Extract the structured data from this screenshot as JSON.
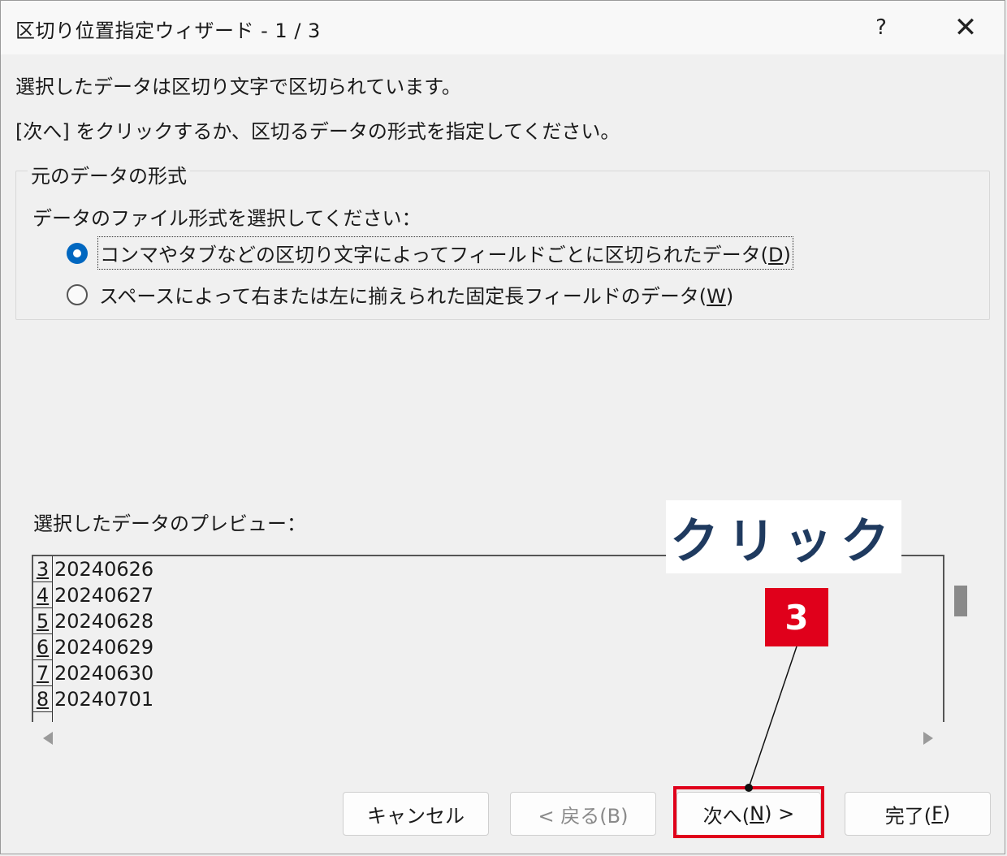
{
  "window": {
    "title": "区切り位置指定ウィザード - 1 / 3",
    "help": "?",
    "close": "✕"
  },
  "intro": {
    "line1": "選択したデータは区切り文字で区切られています。",
    "line2": "[次へ] をクリックするか、区切るデータの形式を指定してください。"
  },
  "format_group": {
    "legend": "元のデータの形式",
    "prompt": "データのファイル形式を選択してください：",
    "options": [
      {
        "label": "コンマやタブなどの区切り文字によってフィールドごとに区切られたデータ(",
        "key": "D",
        "suffix": ")",
        "selected": true
      },
      {
        "label": "スペースによって右または左に揃えられた固定長フィールドのデータ(",
        "key": "W",
        "suffix": ")",
        "selected": false
      }
    ]
  },
  "preview": {
    "label": "選択したデータのプレビュー：",
    "rows": [
      {
        "num": "3",
        "value": "20240626"
      },
      {
        "num": "4",
        "value": "20240627"
      },
      {
        "num": "5",
        "value": "20240628"
      },
      {
        "num": "6",
        "value": "20240629"
      },
      {
        "num": "7",
        "value": "20240630"
      },
      {
        "num": "8",
        "value": "20240701"
      }
    ]
  },
  "buttons": {
    "cancel": "キャンセル",
    "back": "< 戻る(B)",
    "next_prefix": "次へ(",
    "next_key": "N",
    "next_suffix": ") >",
    "finish_prefix": "完了(",
    "finish_key": "F",
    "finish_suffix": ")"
  },
  "annotation": {
    "callout": "クリック",
    "step": "3",
    "highlight_color": "#e0001b",
    "callout_text_color": "#1f3a5f"
  },
  "colors": {
    "accent": "#0067c0",
    "background": "#f0f0f0"
  }
}
